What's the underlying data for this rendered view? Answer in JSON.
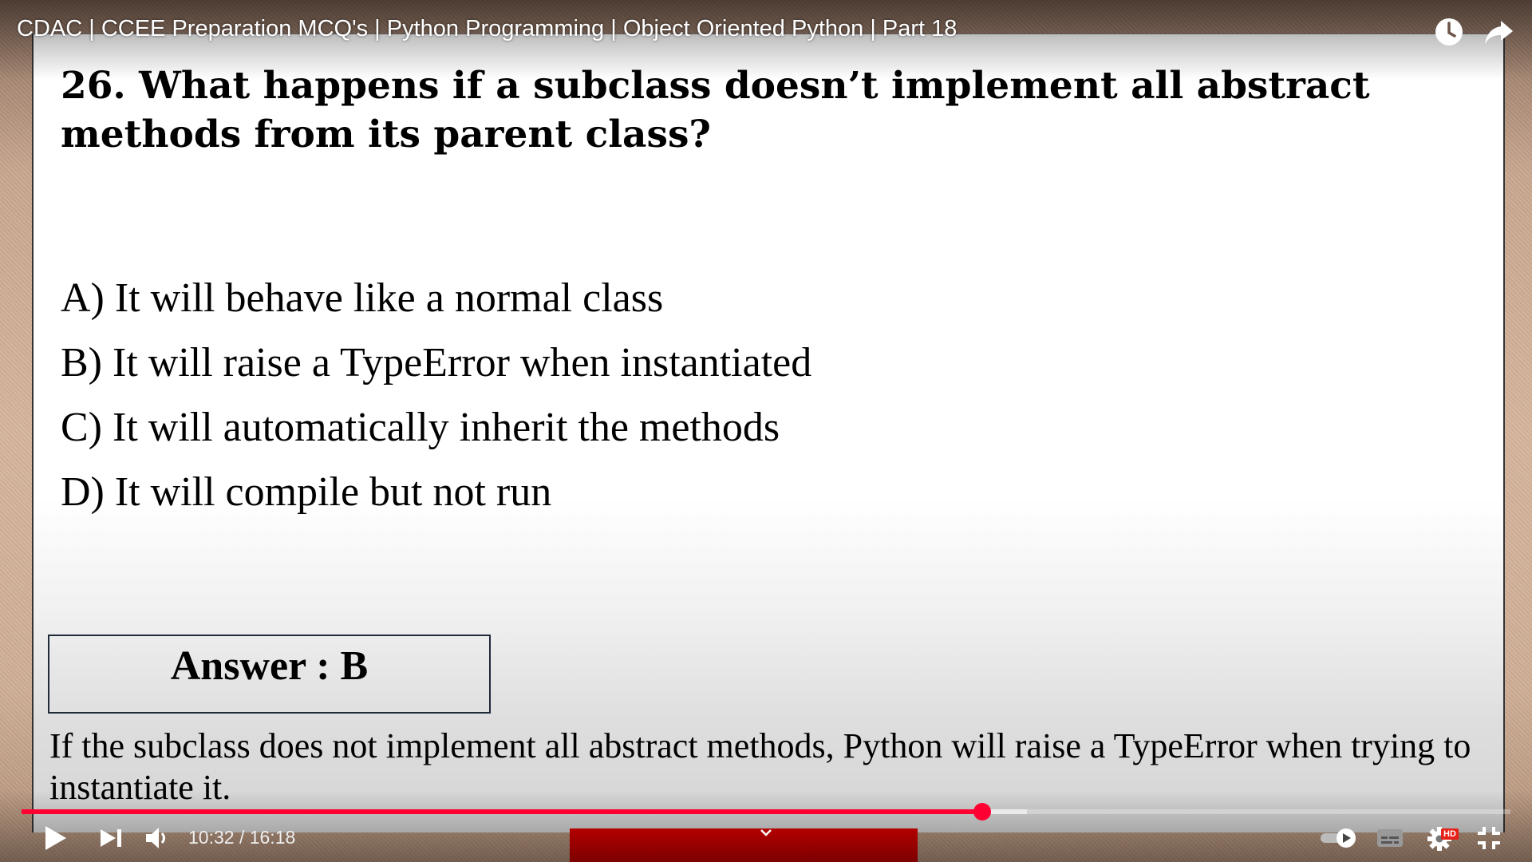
{
  "video": {
    "title": "CDAC | CCEE Preparation MCQ's | Python Programming | Object Oriented Python | Part 18"
  },
  "slide": {
    "question": "26. What happens if  a subclass doesn’t implement all abstract methods from its parent class?",
    "options": [
      "A) It will behave like a normal class",
      "B) It will raise a TypeError when instantiated",
      "C) It will automatically inherit the methods",
      "D) It will compile but not run"
    ],
    "answer": "Answer : B",
    "explanation": "If  the subclass does not implement all abstract methods, Python will raise a TypeError when trying to instantiate it."
  },
  "player": {
    "time_display": "10:32 / 16:18",
    "played_fraction": 0.645,
    "buffered_fraction": 0.567,
    "hd_badge": "HD",
    "colors": {
      "accent": "#ff0033",
      "control": "#ffffff"
    }
  },
  "icons": {
    "top": [
      "watch-later-icon",
      "share-icon"
    ],
    "controls": [
      "play-icon",
      "next-icon",
      "volume-icon",
      "autoplay-toggle",
      "subtitles-icon",
      "settings-icon",
      "exit-fullscreen-icon"
    ]
  }
}
